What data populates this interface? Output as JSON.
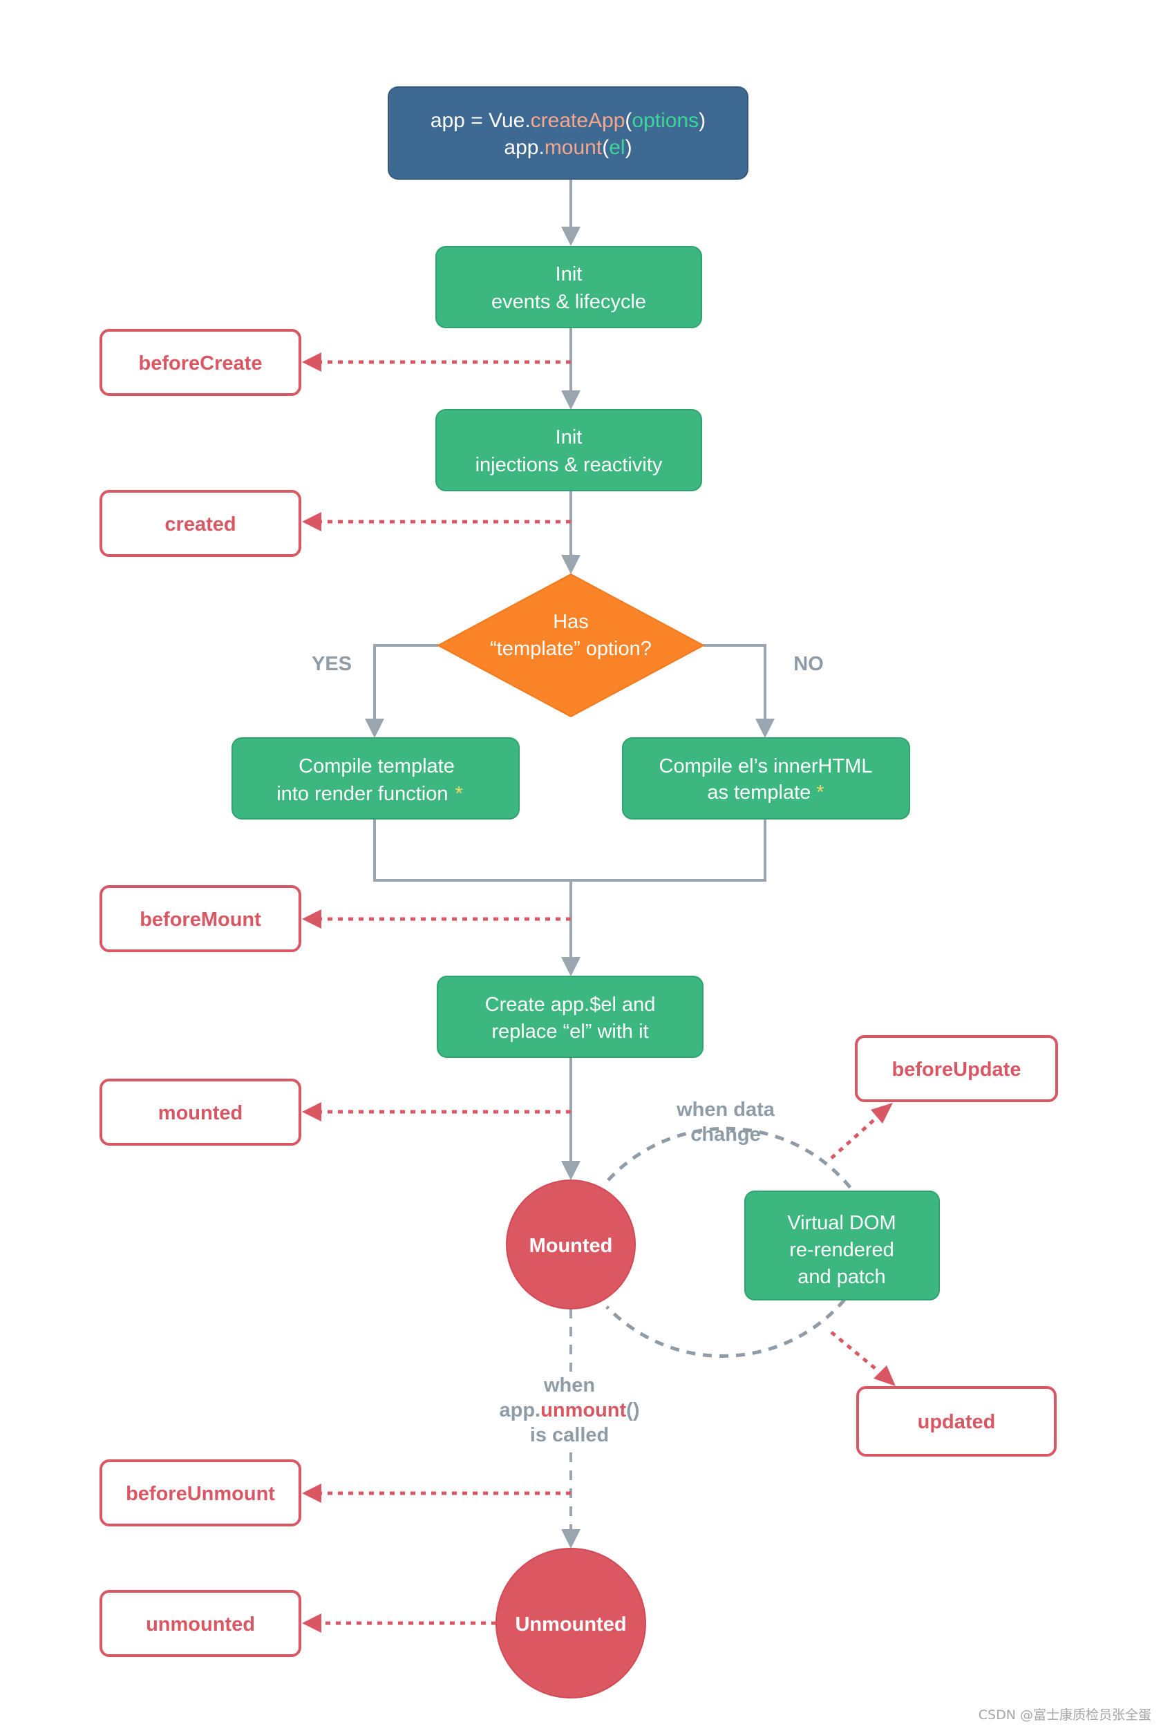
{
  "colors": {
    "start_fill": "#3d6992",
    "process_fill": "#3bb77f",
    "process_stroke": "#2ea36e",
    "decision_fill": "#fc8428",
    "hook_stroke": "#d95763",
    "state_fill": "#db5761",
    "connector": "#9aa6af",
    "code_method": "#f6a78d",
    "code_arg": "#3fd69a",
    "asterisk": "#f5d76e",
    "label_grey": "#8f9ba5"
  },
  "start": {
    "line1": {
      "prefix": "app = Vue.",
      "method": "createApp",
      "open": "(",
      "arg": "options",
      "close": ")"
    },
    "line2": {
      "prefix": "app.",
      "method": "mount",
      "open": "(",
      "arg": "el",
      "close": ")"
    }
  },
  "steps": {
    "init_events": [
      "Init",
      "events & lifecycle"
    ],
    "init_injections": [
      "Init",
      "injections & reactivity"
    ],
    "decision": [
      "Has",
      "“template” option?"
    ],
    "compile_template": [
      "Compile template",
      "into render function"
    ],
    "compile_el": [
      "Compile el’s innerHTML",
      "as template"
    ],
    "asterisk": "*",
    "create_el": [
      "Create app.$el and",
      "replace “el” with it"
    ],
    "virtual_dom": [
      "Virtual DOM",
      "re-rendered",
      "and patch"
    ]
  },
  "branch_labels": {
    "yes": "YES",
    "no": "NO"
  },
  "hooks": {
    "beforeCreate": "beforeCreate",
    "created": "created",
    "beforeMount": "beforeMount",
    "mounted": "mounted",
    "beforeUpdate": "beforeUpdate",
    "updated": "updated",
    "beforeUnmount": "beforeUnmount",
    "unmounted": "unmounted"
  },
  "states": {
    "mounted": "Mounted",
    "unmounted": "Unmounted"
  },
  "annotations": {
    "data_change": [
      "when data",
      "change"
    ],
    "unmount_called": {
      "line1": "when",
      "prefix": "app.",
      "method": "unmount",
      "suffix": "()",
      "line3": "is called"
    }
  },
  "watermark": "CSDN @富士康质检员张全蛋"
}
